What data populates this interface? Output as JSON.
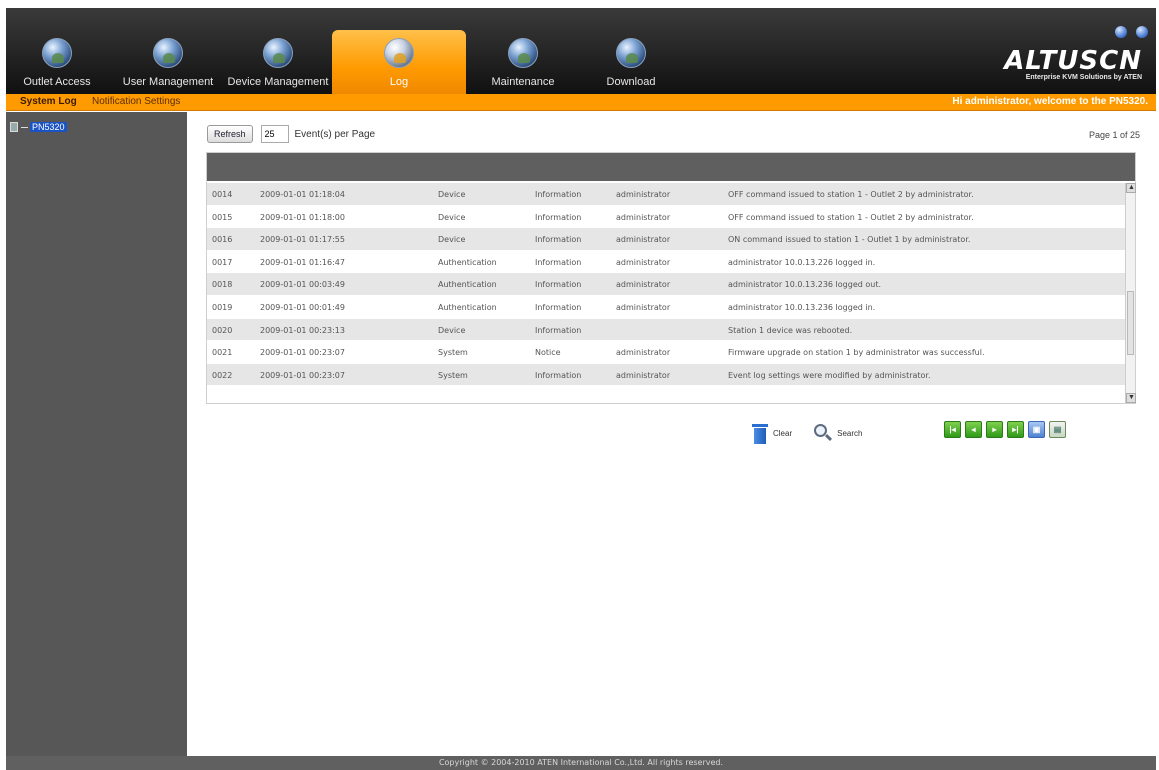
{
  "header": {
    "tabs": [
      {
        "label": "Outlet Access",
        "icon": "globe-icon",
        "active": false
      },
      {
        "label": "User Management",
        "icon": "globe-icon",
        "active": false
      },
      {
        "label": "Device Management",
        "icon": "globe-icon",
        "active": false
      },
      {
        "label": "Log",
        "icon": "globe-icon",
        "active": true
      },
      {
        "label": "Maintenance",
        "icon": "globe-icon",
        "active": false
      },
      {
        "label": "Download",
        "icon": "globe-icon",
        "active": false
      }
    ],
    "brand": {
      "name": "ALTUSCN",
      "tagline": "Enterprise KVM Solutions by ATEN"
    }
  },
  "subnav": {
    "items": [
      {
        "label": "System Log",
        "selected": true
      },
      {
        "label": "Notification Settings",
        "selected": false
      }
    ],
    "welcome": "Hi administrator, welcome to the PN5320."
  },
  "sidebar": {
    "tree_node": "PN5320"
  },
  "toolbar": {
    "refresh_label": "Refresh",
    "per_page_value": "25",
    "per_page_label": "Event(s) per Page",
    "page_info": "Page 1 of 25"
  },
  "log": {
    "rows": [
      {
        "id": "0014",
        "time": "2009-01-01 01:18:04",
        "category": "Device",
        "level": "Information",
        "user": "administrator",
        "description": "OFF command issued to station 1 - Outlet 2 by administrator."
      },
      {
        "id": "0015",
        "time": "2009-01-01 01:18:00",
        "category": "Device",
        "level": "Information",
        "user": "administrator",
        "description": "OFF command issued to station 1 - Outlet 2 by administrator."
      },
      {
        "id": "0016",
        "time": "2009-01-01 01:17:55",
        "category": "Device",
        "level": "Information",
        "user": "administrator",
        "description": "ON command issued to station 1 - Outlet 1 by administrator."
      },
      {
        "id": "0017",
        "time": "2009-01-01 01:16:47",
        "category": "Authentication",
        "level": "Information",
        "user": "administrator",
        "description": "administrator 10.0.13.226 logged in."
      },
      {
        "id": "0018",
        "time": "2009-01-01 00:03:49",
        "category": "Authentication",
        "level": "Information",
        "user": "administrator",
        "description": "administrator 10.0.13.236 logged out."
      },
      {
        "id": "0019",
        "time": "2009-01-01 00:01:49",
        "category": "Authentication",
        "level": "Information",
        "user": "administrator",
        "description": "administrator 10.0.13.236 logged in."
      },
      {
        "id": "0020",
        "time": "2009-01-01 00:23:13",
        "category": "Device",
        "level": "Information",
        "user": "",
        "description": "Station 1 device was rebooted."
      },
      {
        "id": "0021",
        "time": "2009-01-01 00:23:07",
        "category": "System",
        "level": "Notice",
        "user": "administrator",
        "description": "Firmware upgrade on station 1 by administrator was successful."
      },
      {
        "id": "0022",
        "time": "2009-01-01 00:23:07",
        "category": "System",
        "level": "Information",
        "user": "administrator",
        "description": "Event log settings were modified by administrator."
      }
    ]
  },
  "actions": {
    "clear_label": "Clear",
    "search_label": "Search"
  },
  "footer": {
    "copyright": "Copyright © 2004-2010 ATEN International Co.,Ltd. All rights reserved."
  },
  "colors": {
    "accent": "#ff9a00",
    "header": "#262626",
    "sidebar": "#575757",
    "pager_green": "#2f9a18"
  }
}
